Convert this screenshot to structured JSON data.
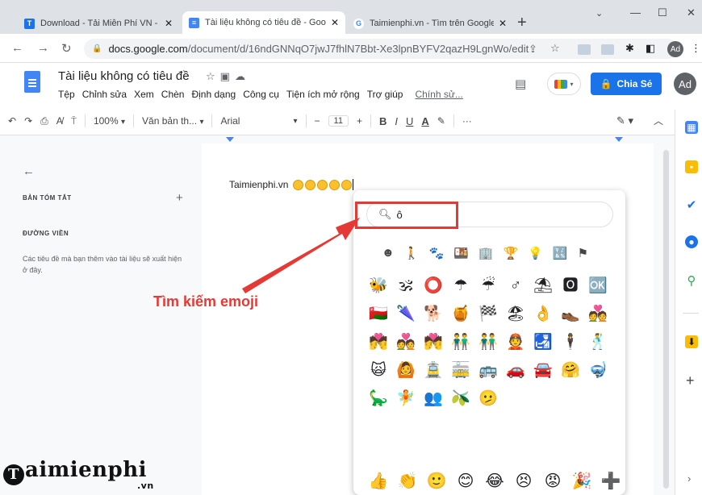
{
  "browser": {
    "tabs": [
      {
        "title": "Download - Tải Miễn Phí VN - Ph",
        "close": "✕",
        "favicon_color": "#1a73e8",
        "favicon_letter": "T"
      },
      {
        "title": "Tài liệu không có tiêu đề - Googl",
        "close": "✕",
        "favicon_color": "#4285f4",
        "favicon_letter": "≡"
      },
      {
        "title": "Taimienphi.vn - Tìm trên Google",
        "close": "✕",
        "favicon_color": "#ffffff",
        "favicon_letter": "G"
      }
    ],
    "new_tab": "+",
    "url_host": "docs.google.com",
    "url_path": "/document/d/16ndGNNqO7jwJ7fhlN7Bbt-Xe3lpnBYFV2qazH9LgnWo/edit",
    "profile": "Ad"
  },
  "docs": {
    "title": "Tài liệu không có tiêu đề",
    "menus": [
      "Tệp",
      "Chỉnh sửa",
      "Xem",
      "Chèn",
      "Định dạng",
      "Công cụ",
      "Tiện ích mở rộng",
      "Trợ giúp"
    ],
    "last_edit": "Chính sử...",
    "share_label": "Chia Sẻ",
    "avatar": "Ad",
    "toolbar": {
      "zoom": "100%",
      "style": "Văn bản th...",
      "font": "Arial",
      "font_size": "11"
    }
  },
  "outline": {
    "summary_label": "BẢN TÓM TẮT",
    "outline_label": "ĐƯỜNG VIỀN",
    "help_text": "Các tiêu đề mà bạn thêm vào tài liệu sẽ xuất hiện ở đây."
  },
  "document": {
    "text": "Taimienphi.vn"
  },
  "emoji_picker": {
    "search_value": "ô",
    "categories": [
      "☻",
      "🚶",
      "🐾",
      "🍱",
      "🏢",
      "🏆",
      "💡",
      "🔣",
      "⚑"
    ],
    "results": [
      "🐝",
      "🕉",
      "⭕",
      "☂",
      "☔",
      "♂",
      "⛱",
      "🅾",
      "🆗",
      "🇴🇲",
      "🌂",
      "🐕",
      "🍯",
      "🏁",
      "🏖",
      "👌",
      "👞",
      "💑",
      "💏",
      "💑",
      "💏",
      "👬",
      "👬",
      "👲",
      "🛃",
      "🕴",
      "🕺",
      "🙀",
      "🙆",
      "🚊",
      "🚋",
      "🚌",
      "🚗",
      "🚘",
      "🤗",
      "🤿",
      "🦕",
      "🧚",
      "👥",
      "🫒",
      "🫤"
    ],
    "recent": [
      "👍",
      "👏",
      "🙂",
      "😊",
      "😂",
      "😣",
      "😡",
      "🎉",
      "➕"
    ]
  },
  "annotation": {
    "label": "Tìm kiếm emoji",
    "color": "#e53935"
  },
  "watermark": {
    "text": "aimienphi",
    "initial": "T",
    "suffix": ".vn"
  }
}
